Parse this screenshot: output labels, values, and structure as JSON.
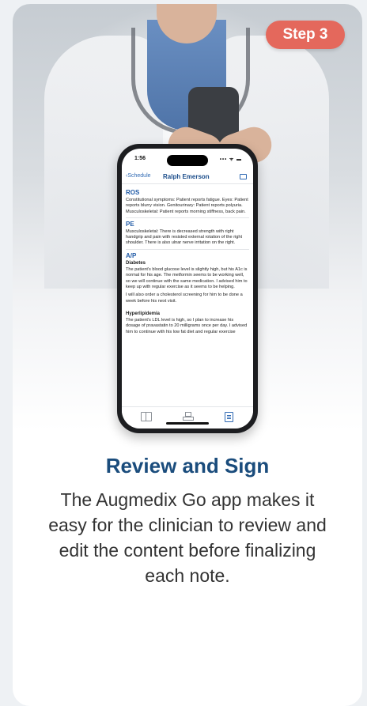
{
  "badge": {
    "label": "Step 3"
  },
  "phone": {
    "status_time": "1:56",
    "status_icons": "••• ᯤ ▬",
    "nav_back": "‹Schedule",
    "nav_title": "Ralph Emerson",
    "sections": {
      "ros": {
        "title": "ROS",
        "text": "Constitutional symptoms: Patient reports fatigue. Eyes: Patient reports blurry vision. Genitourinary: Patient reports polyuria. Musculoskeletal: Patient reports morning stiffness, back pain."
      },
      "pe": {
        "title": "PE",
        "text": "Musculoskeletal: There is decreased strength with right handgrip and pain with resisted external rotation of the right shoulder. There is also ulnar nerve irritation on the right."
      },
      "ap": {
        "title": "A/P",
        "diabetes_title": "Diabetes",
        "diabetes_text": "The patient's blood glucose level is slightly high, but his A1c is normal for his age. The metformin seems to be working well, so we will continue with the same medication. I advised him to keep up with regular exercise as it seems to be helping.",
        "diabetes_text2": "I will also order a cholesterol screening for him to be done a week before his next visit.",
        "hyper_title": "Hyperlipidemia",
        "hyper_text": "The patient's LDL level is high, so I plan to increase his dosage of pravastatin to 20 milligrams once per day. I advised him to continue with his low fat diet and regular exercise"
      }
    },
    "tabs": [
      "book-icon",
      "org-chart-icon",
      "document-icon"
    ]
  },
  "headline": "Review and Sign",
  "description": "The Augmedix Go app makes it easy for the clinician to review and edit the content before finalizing each note.",
  "colors": {
    "accent": "#1a4c7c",
    "badge": "#e4685c",
    "link": "#2f69b3"
  }
}
